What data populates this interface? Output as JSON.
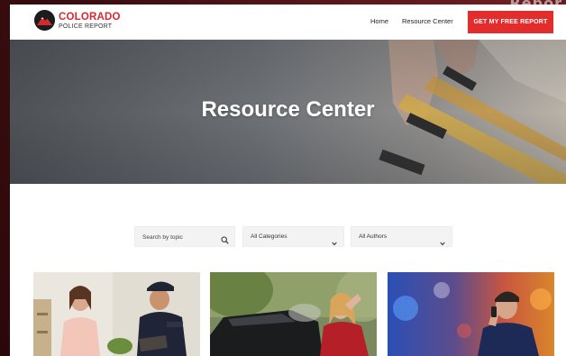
{
  "brand": {
    "name_line1": "COLORADO",
    "name_line2": "POLICE REPORT"
  },
  "backdrop_text": "Repor",
  "nav": {
    "home": "Home",
    "resource_center": "Resource Center",
    "cta": "GET MY FREE REPORT"
  },
  "hero": {
    "title": "Resource Center"
  },
  "filters": {
    "search_placeholder": "Search by topic",
    "category_selected": "All Categories",
    "author_selected": "All Authors"
  },
  "cards": [
    {
      "image": "woman talking with police officer"
    },
    {
      "image": "distressed woman by damaged car"
    },
    {
      "image": "worried man on phone with police lights"
    }
  ],
  "colors": {
    "brand_red": "#e22d2c",
    "logo_red": "#d7282f",
    "backdrop": "#3a0d10"
  },
  "icons": {
    "logo": "mountain-logo-icon",
    "search": "search-icon",
    "dropdown": "chevron-down-icon"
  }
}
